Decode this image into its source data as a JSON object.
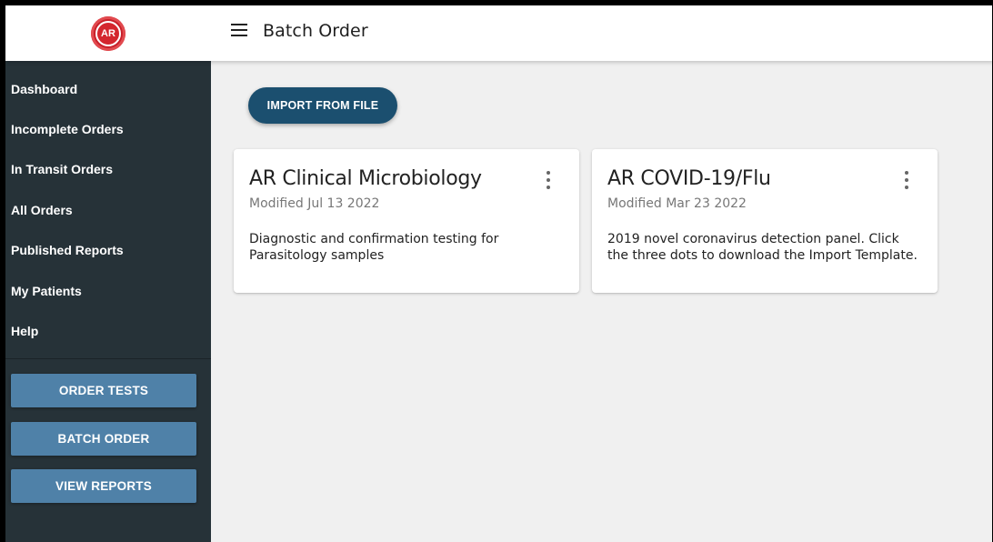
{
  "header": {
    "logo_text": "AR",
    "title": "Batch Order"
  },
  "sidebar": {
    "items": [
      {
        "label": "Dashboard"
      },
      {
        "label": "Incomplete Orders"
      },
      {
        "label": "In Transit Orders"
      },
      {
        "label": "All Orders"
      },
      {
        "label": "Published Reports"
      },
      {
        "label": "My Patients"
      },
      {
        "label": "Help"
      }
    ],
    "buttons": [
      {
        "label": "ORDER TESTS"
      },
      {
        "label": "BATCH ORDER"
      },
      {
        "label": "VIEW REPORTS"
      }
    ]
  },
  "main": {
    "import_label": "IMPORT FROM FILE",
    "cards": [
      {
        "title": "AR Clinical Microbiology",
        "modified": "Modified Jul 13 2022",
        "description": "Diagnostic and confirmation testing for Parasitology samples"
      },
      {
        "title": "AR COVID-19/Flu",
        "modified": "Modified Mar 23 2022",
        "description": "2019 novel coronavirus detection panel. Click the three dots to download the Import Template."
      }
    ]
  },
  "colors": {
    "sidebar_bg": "#263238",
    "sidebar_button": "#4f81a8",
    "primary_button": "#1b4f6f",
    "logo_red": "#c8202a",
    "content_bg": "#f0f0f0"
  },
  "icons": {
    "menu": "hamburger-menu-icon",
    "card_menu": "more-vertical-icon",
    "logo": "ar-logo"
  }
}
